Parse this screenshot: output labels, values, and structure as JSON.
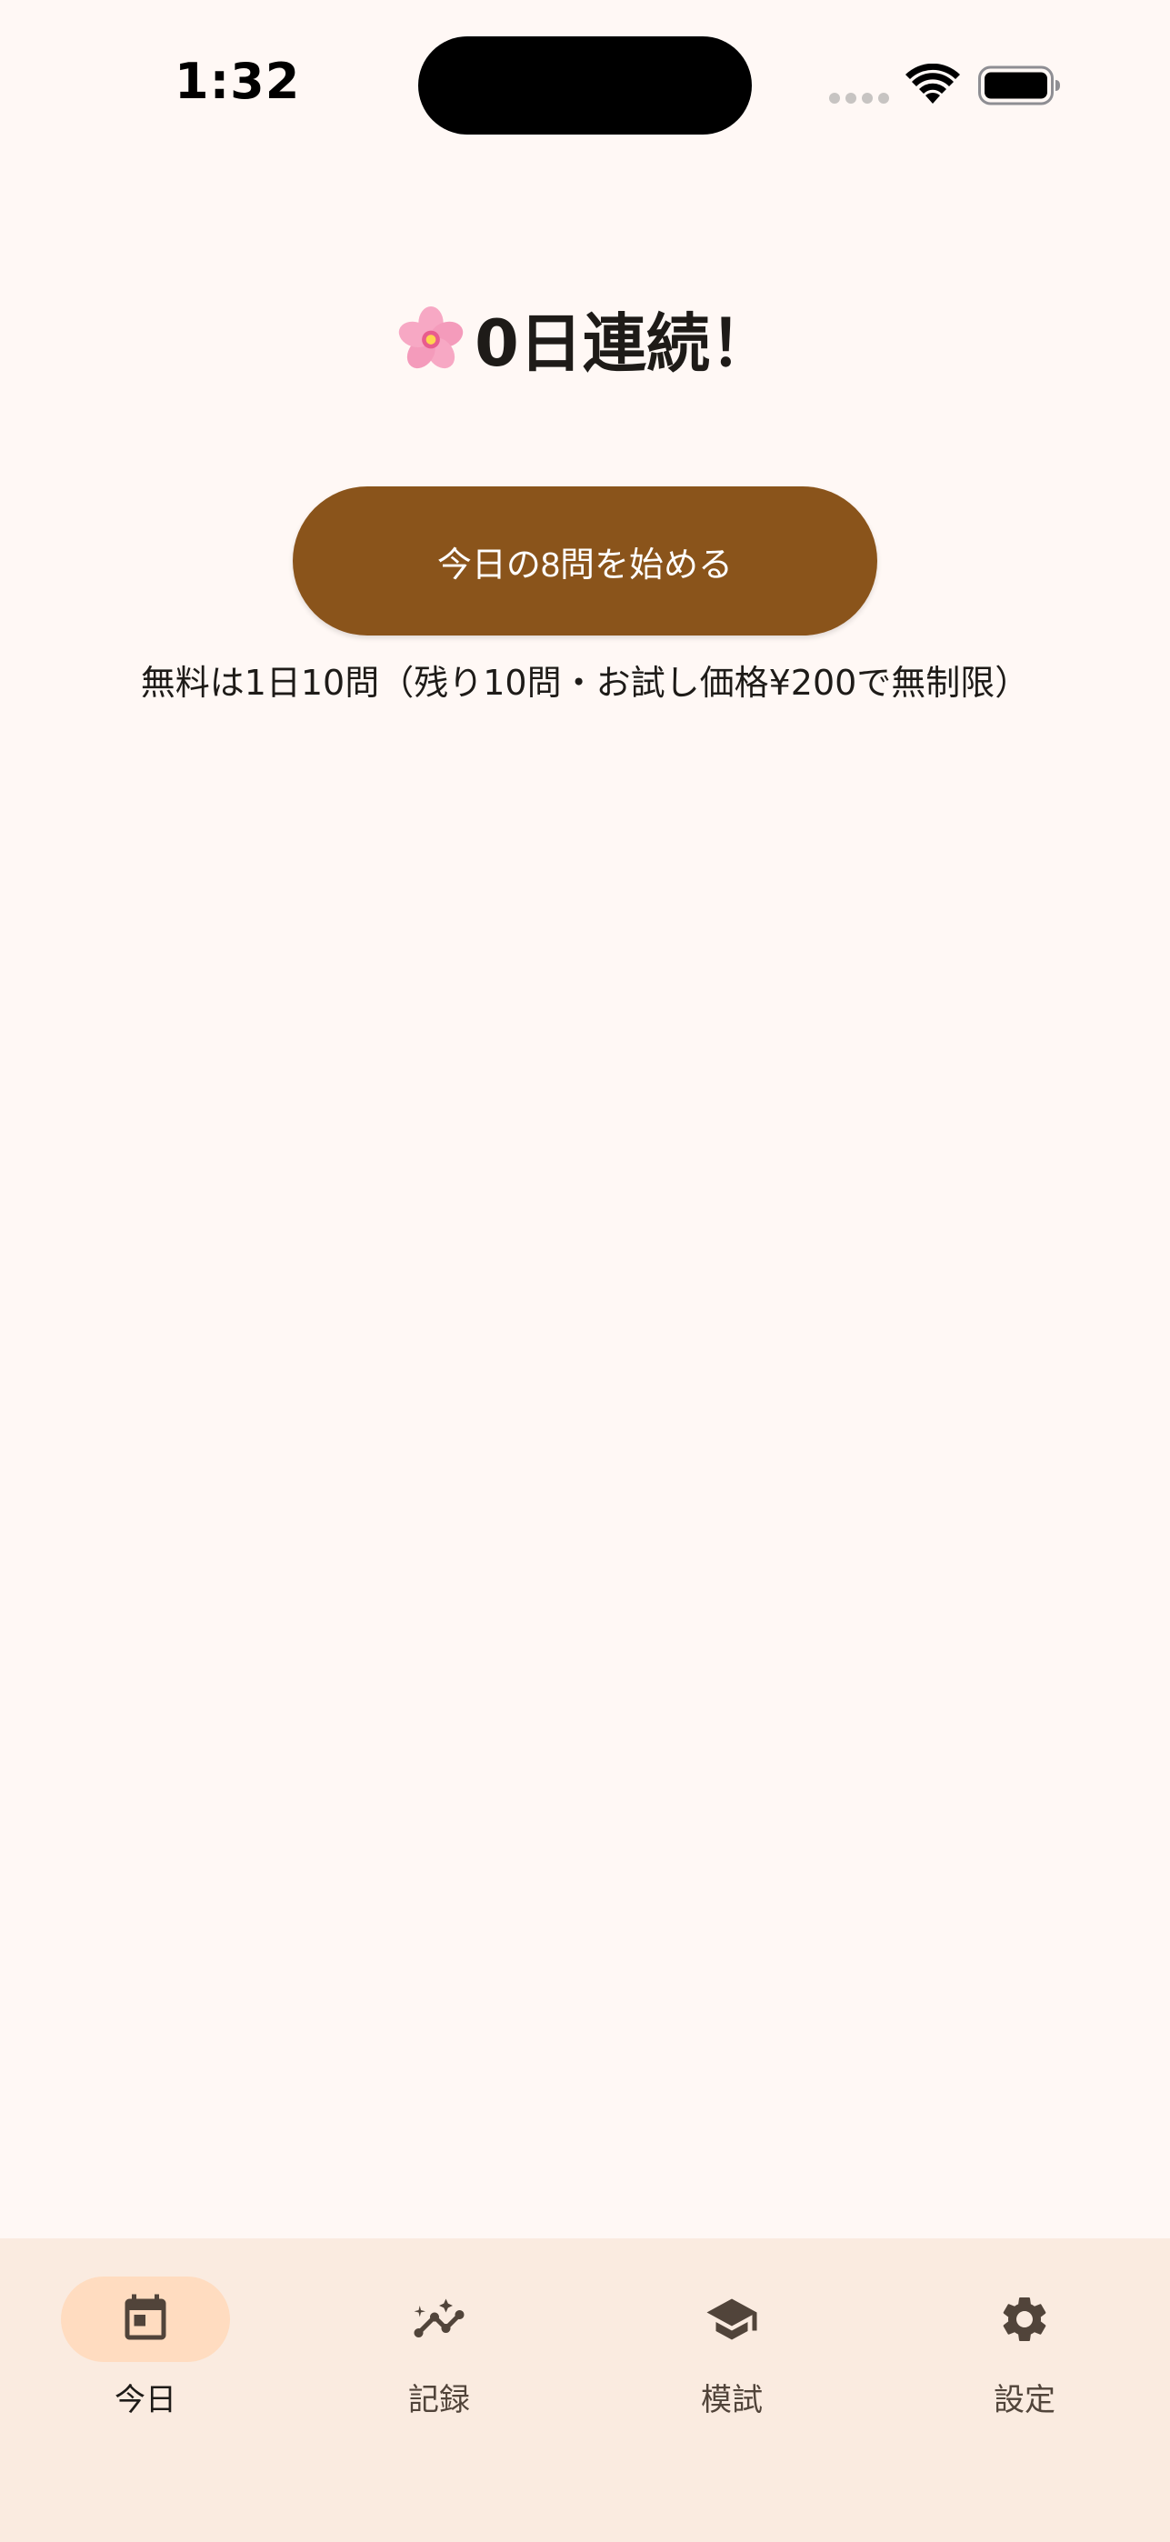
{
  "status_bar": {
    "time": "1:32",
    "icons": [
      "signal-dots-icon",
      "wifi-icon",
      "battery-icon"
    ]
  },
  "streak": {
    "icon": "cherry-blossom-icon",
    "title": "0日連続！"
  },
  "start_button": {
    "label": "今日の8問を始める"
  },
  "free_note": "無料は1日10問（残り10問・お試し価格¥200で無制限）",
  "bottom_nav": {
    "items": [
      {
        "label": "今日",
        "icon": "calendar-icon",
        "active": true
      },
      {
        "label": "記録",
        "icon": "insights-chart-icon",
        "active": false
      },
      {
        "label": "模試",
        "icon": "graduation-cap-icon",
        "active": false
      },
      {
        "label": "設定",
        "icon": "gear-icon",
        "active": false
      }
    ]
  },
  "colors": {
    "background": "#FFF8F5",
    "primary_button": "#8A541B",
    "nav_background": "#FAEBE0",
    "nav_active_indicator": "#FFDCC0",
    "icon": "#51443A"
  }
}
